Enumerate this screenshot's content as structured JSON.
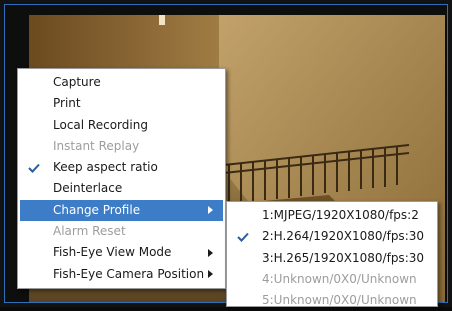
{
  "context_menu": {
    "items": [
      {
        "label": "Capture",
        "enabled": true,
        "checked": false,
        "submenu": false
      },
      {
        "label": "Print",
        "enabled": true,
        "checked": false,
        "submenu": false
      },
      {
        "label": "Local Recording",
        "enabled": true,
        "checked": false,
        "submenu": false
      },
      {
        "label": "Instant Replay",
        "enabled": false,
        "checked": false,
        "submenu": false
      },
      {
        "label": "Keep aspect ratio",
        "enabled": true,
        "checked": true,
        "submenu": false
      },
      {
        "label": "Deinterlace",
        "enabled": true,
        "checked": false,
        "submenu": false
      },
      {
        "label": "Change Profile",
        "enabled": true,
        "checked": false,
        "submenu": true,
        "highlighted": true
      },
      {
        "label": "Alarm Reset",
        "enabled": false,
        "checked": false,
        "submenu": false
      },
      {
        "label": "Fish-Eye View Mode",
        "enabled": true,
        "checked": false,
        "submenu": true
      },
      {
        "label": "Fish-Eye Camera Position",
        "enabled": true,
        "checked": false,
        "submenu": true
      }
    ]
  },
  "profile_submenu": {
    "items": [
      {
        "label": "1:MJPEG/1920X1080/fps:2",
        "enabled": true,
        "checked": false
      },
      {
        "label": "2:H.264/1920X1080/fps:30",
        "enabled": true,
        "checked": true
      },
      {
        "label": "3:H.265/1920X1080/fps:30",
        "enabled": true,
        "checked": false
      },
      {
        "label": "4:Unknown/0X0/Unknown",
        "enabled": false,
        "checked": false
      },
      {
        "label": "5:Unknown/0X0/Unknown",
        "enabled": false,
        "checked": false
      }
    ]
  },
  "colors": {
    "highlight": "#3d7cc6",
    "frame_border": "#2f6fb8",
    "check_mark": "#2a5d9a"
  },
  "icons": {
    "check": "check-icon",
    "submenu": "chevron-right-icon"
  }
}
